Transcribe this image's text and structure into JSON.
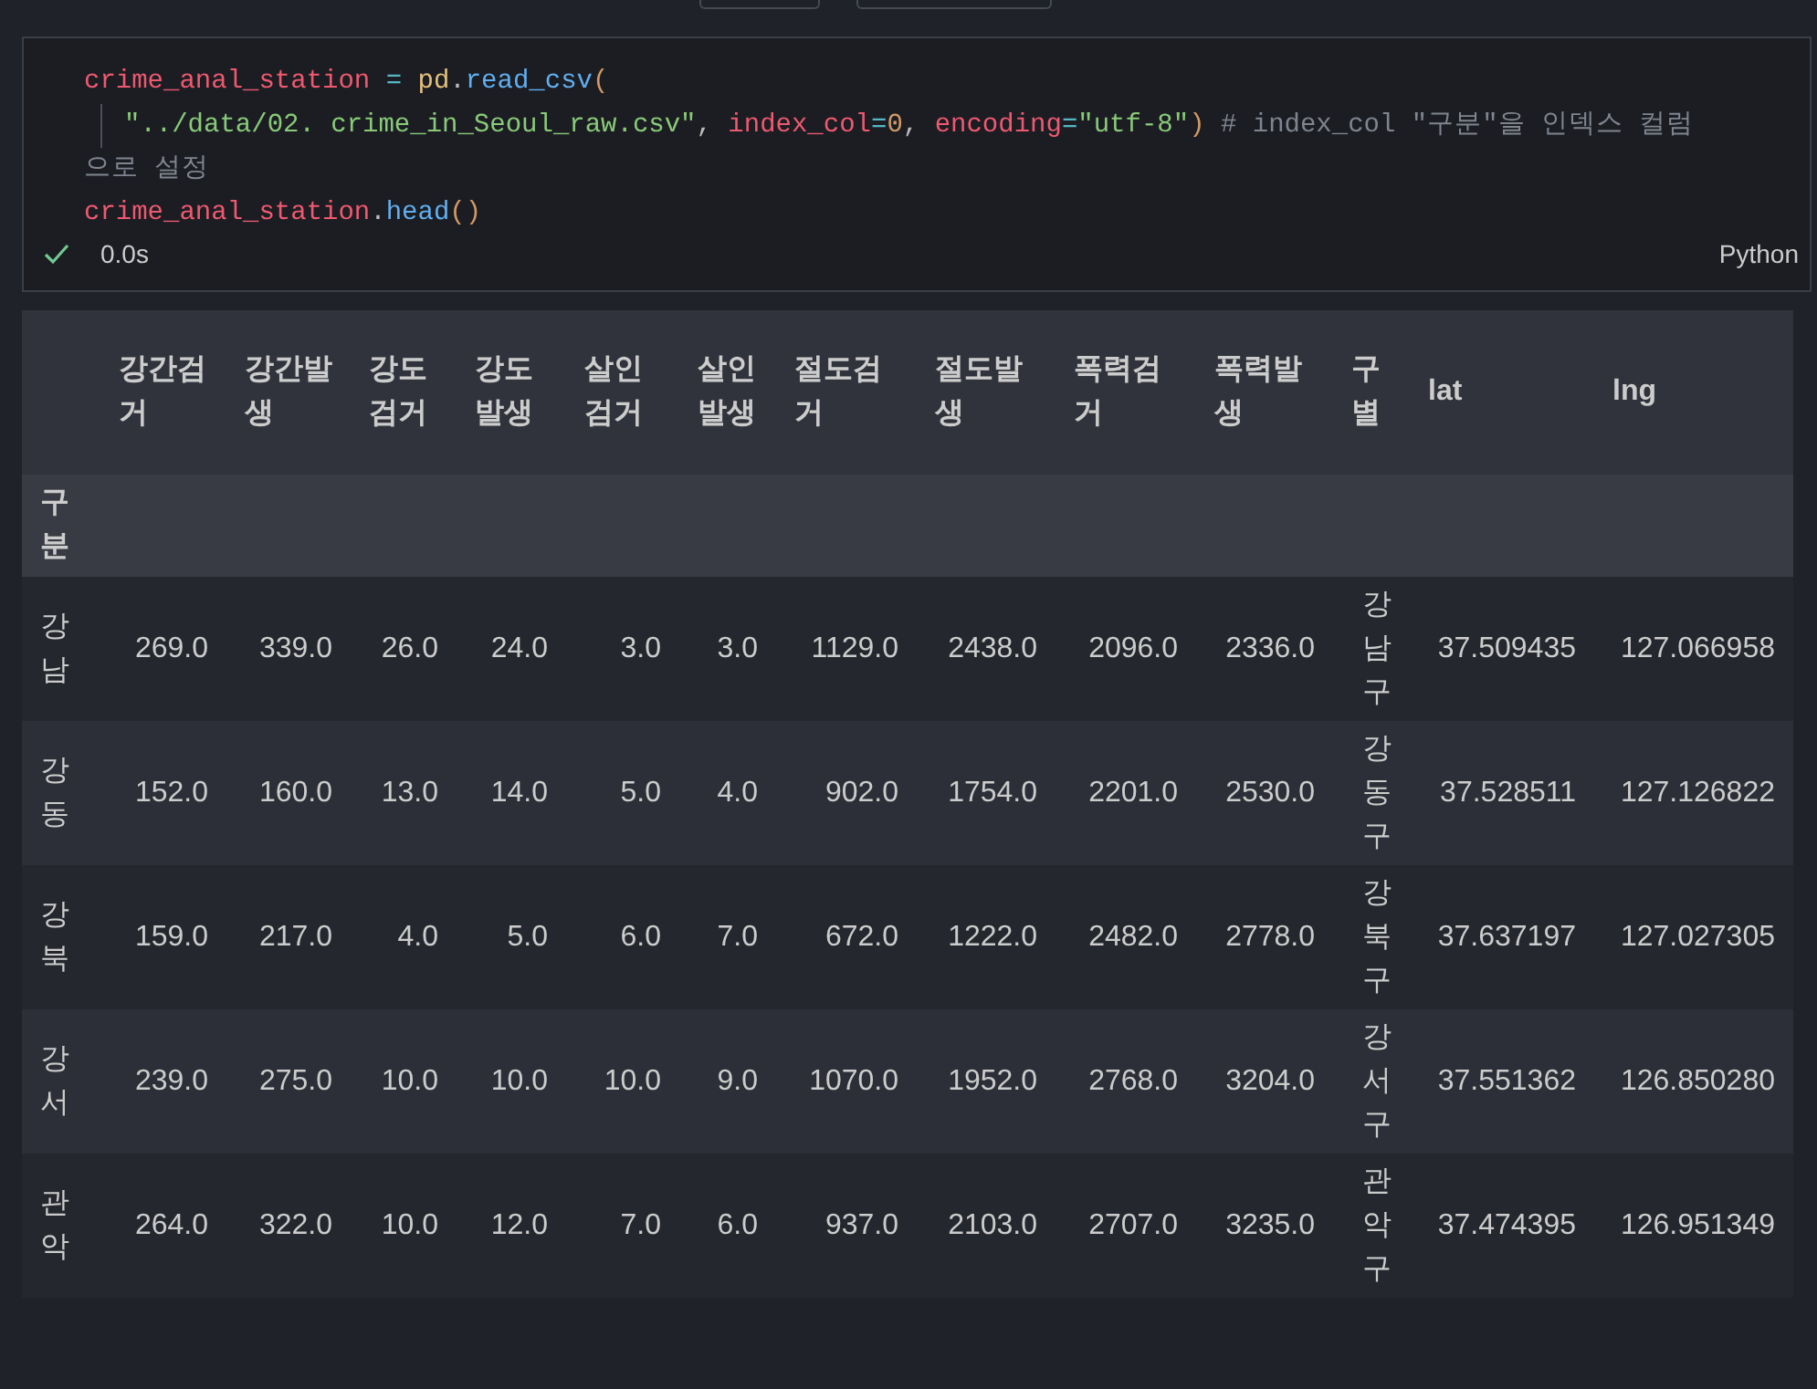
{
  "code_cell": {
    "lines": [
      {
        "indented": false,
        "tokens": [
          {
            "kind": "var",
            "text": "crime_anal_station"
          },
          {
            "kind": "op",
            "text": " = "
          },
          {
            "kind": "module",
            "text": "pd"
          },
          {
            "kind": "plain",
            "text": "."
          },
          {
            "kind": "func",
            "text": "read_csv"
          },
          {
            "kind": "bracket",
            "text": "("
          }
        ]
      },
      {
        "indented": true,
        "tokens": [
          {
            "kind": "str",
            "text": "\"../data/02. crime_in_Seoul_raw.csv\""
          },
          {
            "kind": "plain",
            "text": ", "
          },
          {
            "kind": "var",
            "text": "index_col"
          },
          {
            "kind": "op",
            "text": "="
          },
          {
            "kind": "num",
            "text": "0"
          },
          {
            "kind": "plain",
            "text": ", "
          },
          {
            "kind": "var",
            "text": "encoding"
          },
          {
            "kind": "op",
            "text": "="
          },
          {
            "kind": "str",
            "text": "\"utf-8\""
          },
          {
            "kind": "bracket",
            "text": ")"
          },
          {
            "kind": "comment",
            "text": " # index_col \"구분\"을 인덱스 컬럼"
          }
        ]
      },
      {
        "indented": false,
        "tokens": [
          {
            "kind": "comment",
            "text": "으로 설정"
          }
        ]
      },
      {
        "indented": false,
        "tokens": [
          {
            "kind": "var",
            "text": "crime_anal_station"
          },
          {
            "kind": "plain",
            "text": "."
          },
          {
            "kind": "func",
            "text": "head"
          },
          {
            "kind": "bracket",
            "text": "()"
          }
        ]
      }
    ],
    "status": {
      "succeeded": true,
      "duration": "0.0s"
    },
    "language": "Python"
  },
  "table": {
    "columns": [
      "강간검거",
      "강간발생",
      "강도검거",
      "강도발생",
      "살인검거",
      "살인발생",
      "절도검거",
      "절도발생",
      "폭력검거",
      "폭력발생",
      "구별",
      "lat",
      "lng"
    ],
    "index_name": "구분",
    "rows": [
      {
        "index": "강남",
        "cells": [
          "269.0",
          "339.0",
          "26.0",
          "24.0",
          "3.0",
          "3.0",
          "1129.0",
          "2438.0",
          "2096.0",
          "2336.0",
          "강남구",
          "37.509435",
          "127.066958"
        ]
      },
      {
        "index": "강동",
        "cells": [
          "152.0",
          "160.0",
          "13.0",
          "14.0",
          "5.0",
          "4.0",
          "902.0",
          "1754.0",
          "2201.0",
          "2530.0",
          "강동구",
          "37.528511",
          "127.126822"
        ]
      },
      {
        "index": "강북",
        "cells": [
          "159.0",
          "217.0",
          "4.0",
          "5.0",
          "6.0",
          "7.0",
          "672.0",
          "1222.0",
          "2482.0",
          "2778.0",
          "강북구",
          "37.637197",
          "127.027305"
        ]
      },
      {
        "index": "강서",
        "cells": [
          "239.0",
          "275.0",
          "10.0",
          "10.0",
          "10.0",
          "9.0",
          "1070.0",
          "1952.0",
          "2768.0",
          "3204.0",
          "강서구",
          "37.551362",
          "126.850280"
        ]
      },
      {
        "index": "관악",
        "cells": [
          "264.0",
          "322.0",
          "10.0",
          "12.0",
          "7.0",
          "6.0",
          "937.0",
          "2103.0",
          "2707.0",
          "3235.0",
          "관악구",
          "37.474395",
          "126.951349"
        ]
      }
    ]
  }
}
